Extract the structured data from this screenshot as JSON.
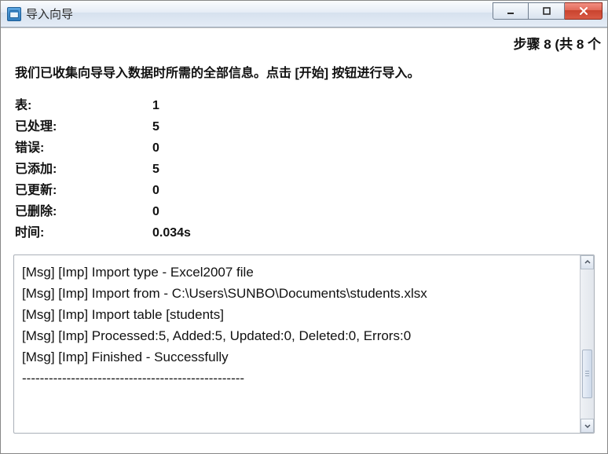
{
  "window": {
    "title": "导入向导"
  },
  "step": {
    "text": "步骤 8 (共 8 个"
  },
  "instruction": "我们已收集向导导入数据时所需的全部信息。点击 [开始] 按钮进行导入。",
  "stats": {
    "rows": [
      {
        "label": "表:",
        "value": "1"
      },
      {
        "label": "已处理:",
        "value": "5"
      },
      {
        "label": "错误:",
        "value": "0"
      },
      {
        "label": "已添加:",
        "value": "5"
      },
      {
        "label": "已更新:",
        "value": "0"
      },
      {
        "label": "已删除:",
        "value": "0"
      },
      {
        "label": "时间:",
        "value": "0.034s"
      }
    ]
  },
  "log": {
    "lines": [
      "[Msg] [Imp] Import type - Excel2007 file",
      "[Msg] [Imp] Import from - C:\\Users\\SUNBO\\Documents\\students.xlsx",
      "[Msg] [Imp] Import table [students]",
      "[Msg] [Imp] Processed:5, Added:5, Updated:0, Deleted:0, Errors:0",
      "[Msg] [Imp] Finished - Successfully",
      "--------------------------------------------------"
    ]
  }
}
